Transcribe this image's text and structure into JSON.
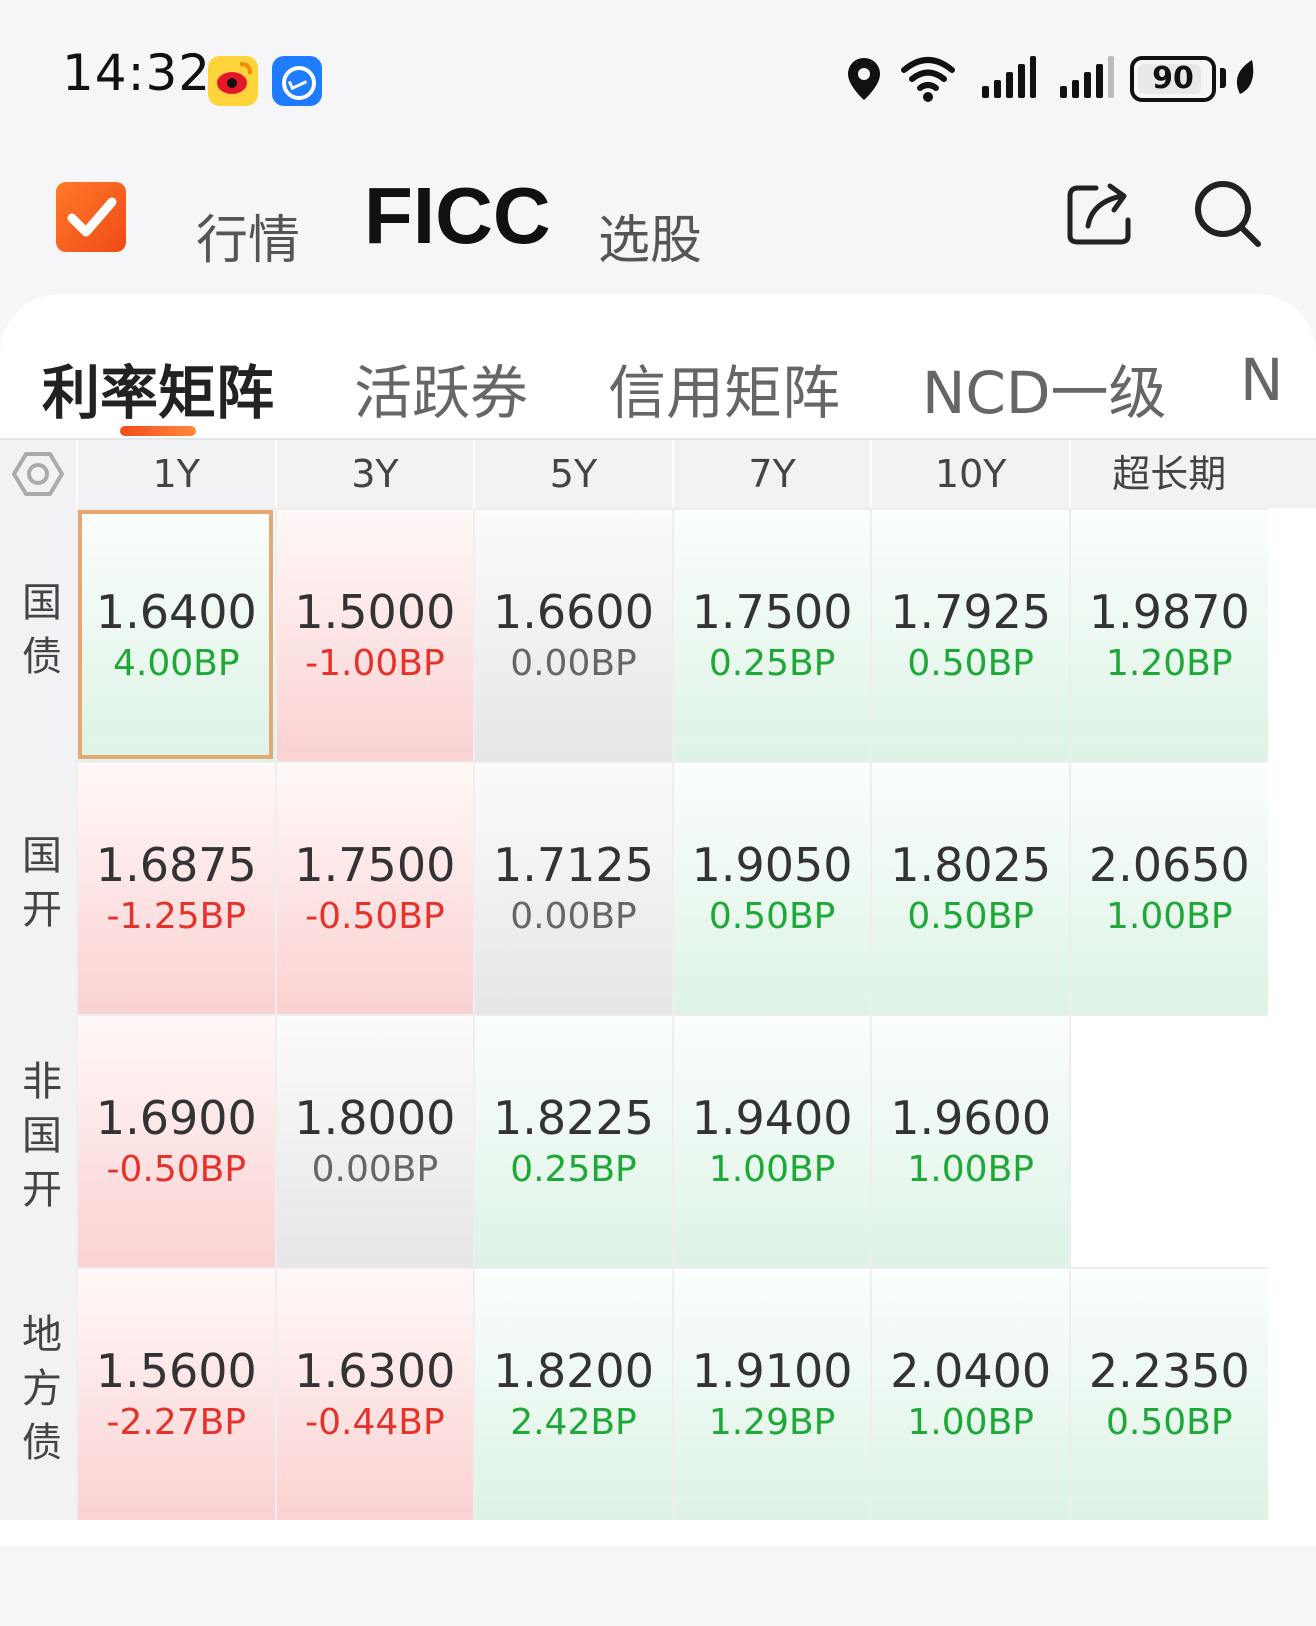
{
  "status_bar": {
    "time": "14:32",
    "battery": "90",
    "battery_level": 0.9,
    "icons": [
      "weibo-icon",
      "app-icon",
      "location-icon",
      "wifi-icon",
      "signal-icon",
      "signal-icon",
      "battery-icon",
      "leaf-icon"
    ]
  },
  "header": {
    "nav": [
      "行情",
      "FICC",
      "选股"
    ],
    "active_nav": "FICC",
    "icons": [
      "logo-icon",
      "share-icon",
      "search-icon"
    ]
  },
  "tabs": [
    {
      "label": "利率矩阵",
      "active": true
    },
    {
      "label": "活跃券",
      "active": false
    },
    {
      "label": "信用矩阵",
      "active": false
    },
    {
      "label": "NCD一级",
      "active": false
    },
    {
      "label": "N",
      "active": false
    }
  ],
  "colors": {
    "up": "#1ea838",
    "down": "#e5332b",
    "flat": "#666666",
    "accent": "#f24a1d",
    "selected_border": "#e5a773"
  },
  "matrix": {
    "columns": [
      "1Y",
      "3Y",
      "5Y",
      "7Y",
      "10Y",
      "超长期"
    ],
    "rows": [
      {
        "label": "国债",
        "cells": [
          {
            "value": "1.6400",
            "change": "4.00BP",
            "trend": "up",
            "selected": true
          },
          {
            "value": "1.5000",
            "change": "-1.00BP",
            "trend": "down"
          },
          {
            "value": "1.6600",
            "change": "0.00BP",
            "trend": "flat"
          },
          {
            "value": "1.7500",
            "change": "0.25BP",
            "trend": "up"
          },
          {
            "value": "1.7925",
            "change": "0.50BP",
            "trend": "up"
          },
          {
            "value": "1.9870",
            "change": "1.20BP",
            "trend": "up"
          }
        ]
      },
      {
        "label": "国开",
        "cells": [
          {
            "value": "1.6875",
            "change": "-1.25BP",
            "trend": "down"
          },
          {
            "value": "1.7500",
            "change": "-0.50BP",
            "trend": "down"
          },
          {
            "value": "1.7125",
            "change": "0.00BP",
            "trend": "flat"
          },
          {
            "value": "1.9050",
            "change": "0.50BP",
            "trend": "up"
          },
          {
            "value": "1.8025",
            "change": "0.50BP",
            "trend": "up"
          },
          {
            "value": "2.0650",
            "change": "1.00BP",
            "trend": "up"
          }
        ]
      },
      {
        "label": "非国开",
        "cells": [
          {
            "value": "1.6900",
            "change": "-0.50BP",
            "trend": "down"
          },
          {
            "value": "1.8000",
            "change": "0.00BP",
            "trend": "flat"
          },
          {
            "value": "1.8225",
            "change": "0.25BP",
            "trend": "up"
          },
          {
            "value": "1.9400",
            "change": "1.00BP",
            "trend": "up"
          },
          {
            "value": "1.9600",
            "change": "1.00BP",
            "trend": "up"
          },
          {
            "value": "",
            "change": "",
            "trend": "empty"
          }
        ]
      },
      {
        "label": "地方债",
        "cells": [
          {
            "value": "1.5600",
            "change": "-2.27BP",
            "trend": "down"
          },
          {
            "value": "1.6300",
            "change": "-0.44BP",
            "trend": "down"
          },
          {
            "value": "1.8200",
            "change": "2.42BP",
            "trend": "up"
          },
          {
            "value": "1.9100",
            "change": "1.29BP",
            "trend": "up"
          },
          {
            "value": "2.0400",
            "change": "1.00BP",
            "trend": "up"
          },
          {
            "value": "2.2350",
            "change": "0.50BP",
            "trend": "up"
          }
        ]
      }
    ]
  }
}
